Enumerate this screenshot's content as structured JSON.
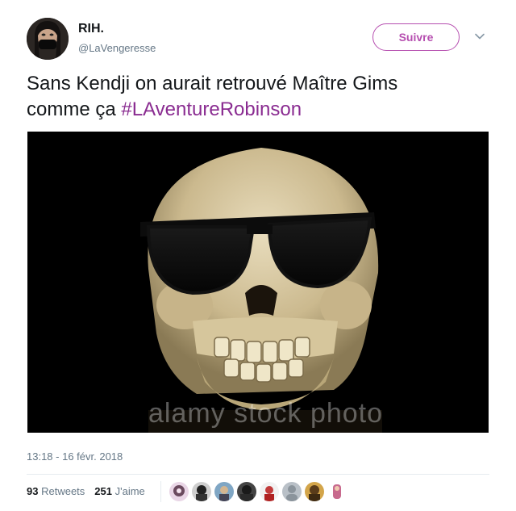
{
  "author": {
    "name": "RIH.",
    "handle": "@LaVengeresse"
  },
  "follow_button": {
    "label": "Suivre"
  },
  "more_icon": "chevron-down-icon",
  "tweet": {
    "text_line1": "Sans Kendji on aurait retrouvé Maître Gims",
    "text_line2_prefix": "comme ça ",
    "hashtag": "#LAventureRobinson",
    "hashtag_color": "#8a2c91"
  },
  "media": {
    "watermark": "alamy stock photo"
  },
  "meta": {
    "timestamp": "13:18 - 16 févr. 2018"
  },
  "stats": {
    "retweets_count": "93",
    "retweets_label": "Retweets",
    "likes_count": "251",
    "likes_label": "J'aime"
  },
  "likers": [
    {
      "icon": "avatar-1"
    },
    {
      "icon": "avatar-2"
    },
    {
      "icon": "avatar-3"
    },
    {
      "icon": "avatar-4"
    },
    {
      "icon": "avatar-5"
    },
    {
      "icon": "avatar-6"
    },
    {
      "icon": "avatar-7"
    },
    {
      "icon": "avatar-8"
    }
  ],
  "colors": {
    "accent": "#b64fb0",
    "text": "#14171a",
    "muted": "#657786"
  }
}
